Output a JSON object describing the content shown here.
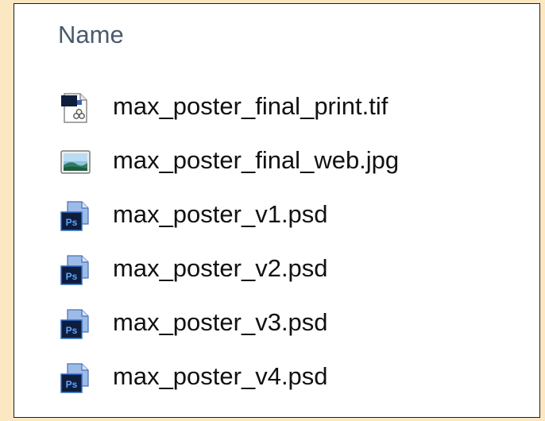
{
  "header": {
    "name_column": "Name"
  },
  "files": [
    {
      "name": "max_poster_final_print.tif",
      "icon": "tif-file-icon"
    },
    {
      "name": "max_poster_final_web.jpg",
      "icon": "jpg-image-file-icon"
    },
    {
      "name": "max_poster_v1.psd",
      "icon": "photoshop-psd-file-icon",
      "badge": "Ps"
    },
    {
      "name": "max_poster_v2.psd",
      "icon": "photoshop-psd-file-icon",
      "badge": "Ps"
    },
    {
      "name": "max_poster_v3.psd",
      "icon": "photoshop-psd-file-icon",
      "badge": "Ps"
    },
    {
      "name": "max_poster_v4.psd",
      "icon": "photoshop-psd-file-icon",
      "badge": "Ps"
    }
  ],
  "colors": {
    "background": "#fbe8c2",
    "header_text": "#4a5a6d",
    "psd_dark": "#0f1d3d",
    "psd_blue": "#2f6fce"
  }
}
